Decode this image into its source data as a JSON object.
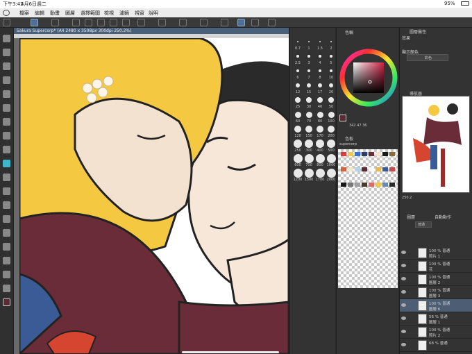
{
  "status": {
    "time": "下午3:42",
    "date": "4月6日週二",
    "battery": "95%"
  },
  "menu": [
    "檔案",
    "編輯",
    "動畫",
    "圖層",
    "選擇範圍",
    "檢視",
    "濾鏡",
    "視窗",
    "說明"
  ],
  "document": {
    "tab_title": "Sakura Supercorp* (A4 2480 x 3508px 300dpi 250.2%)"
  },
  "brush_sizes": [
    "0.7",
    "1",
    "1.5",
    "2",
    "2.5",
    "3",
    "4",
    "5",
    "6",
    "7",
    "8",
    "10",
    "12",
    "15",
    "17",
    "20",
    "25",
    "30",
    "40",
    "50",
    "60",
    "70",
    "80",
    "100",
    "120",
    "150",
    "170",
    "200",
    "250",
    "300",
    "400",
    "500",
    "600",
    "700",
    "800",
    "1000",
    "1200",
    "1500",
    "1700",
    "2000"
  ],
  "color_wheel": {
    "title": "色輪",
    "readout": "342 47 36"
  },
  "color_set": {
    "title": "色板",
    "name": "supercorp"
  },
  "property_panel": {
    "title": "圖層屬性",
    "effect_label": "效果",
    "display_color_label": "顯示顏色",
    "display_color_value": "彩色"
  },
  "navigator": {
    "title": "導航器",
    "zoom": "250.2"
  },
  "layers": {
    "tab1": "圖層",
    "tab2": "自動動作",
    "blend_mode": "普通",
    "items": [
      {
        "opacity": "100 %",
        "mode": "普通",
        "name": "照片 1"
      },
      {
        "opacity": "100 %",
        "mode": "普通",
        "name": "花"
      },
      {
        "opacity": "100 %",
        "mode": "普通",
        "name": "圖層 2"
      },
      {
        "opacity": "100 %",
        "mode": "普通",
        "name": "圖層 3"
      },
      {
        "opacity": "100 %",
        "mode": "普通",
        "name": "圖層 6"
      },
      {
        "opacity": "56 %",
        "mode": "普通",
        "name": "圖層 1"
      },
      {
        "opacity": "100 %",
        "mode": "普通",
        "name": "照片 2"
      },
      {
        "opacity": "68 %",
        "mode": "普通",
        "name": ""
      }
    ]
  },
  "colors": {
    "accent": "#4f6f99",
    "selected_layer": "#4d5d73",
    "hair": "#f5c842",
    "jacket": "#6b2c3a",
    "skin": "#f3e2d0"
  }
}
